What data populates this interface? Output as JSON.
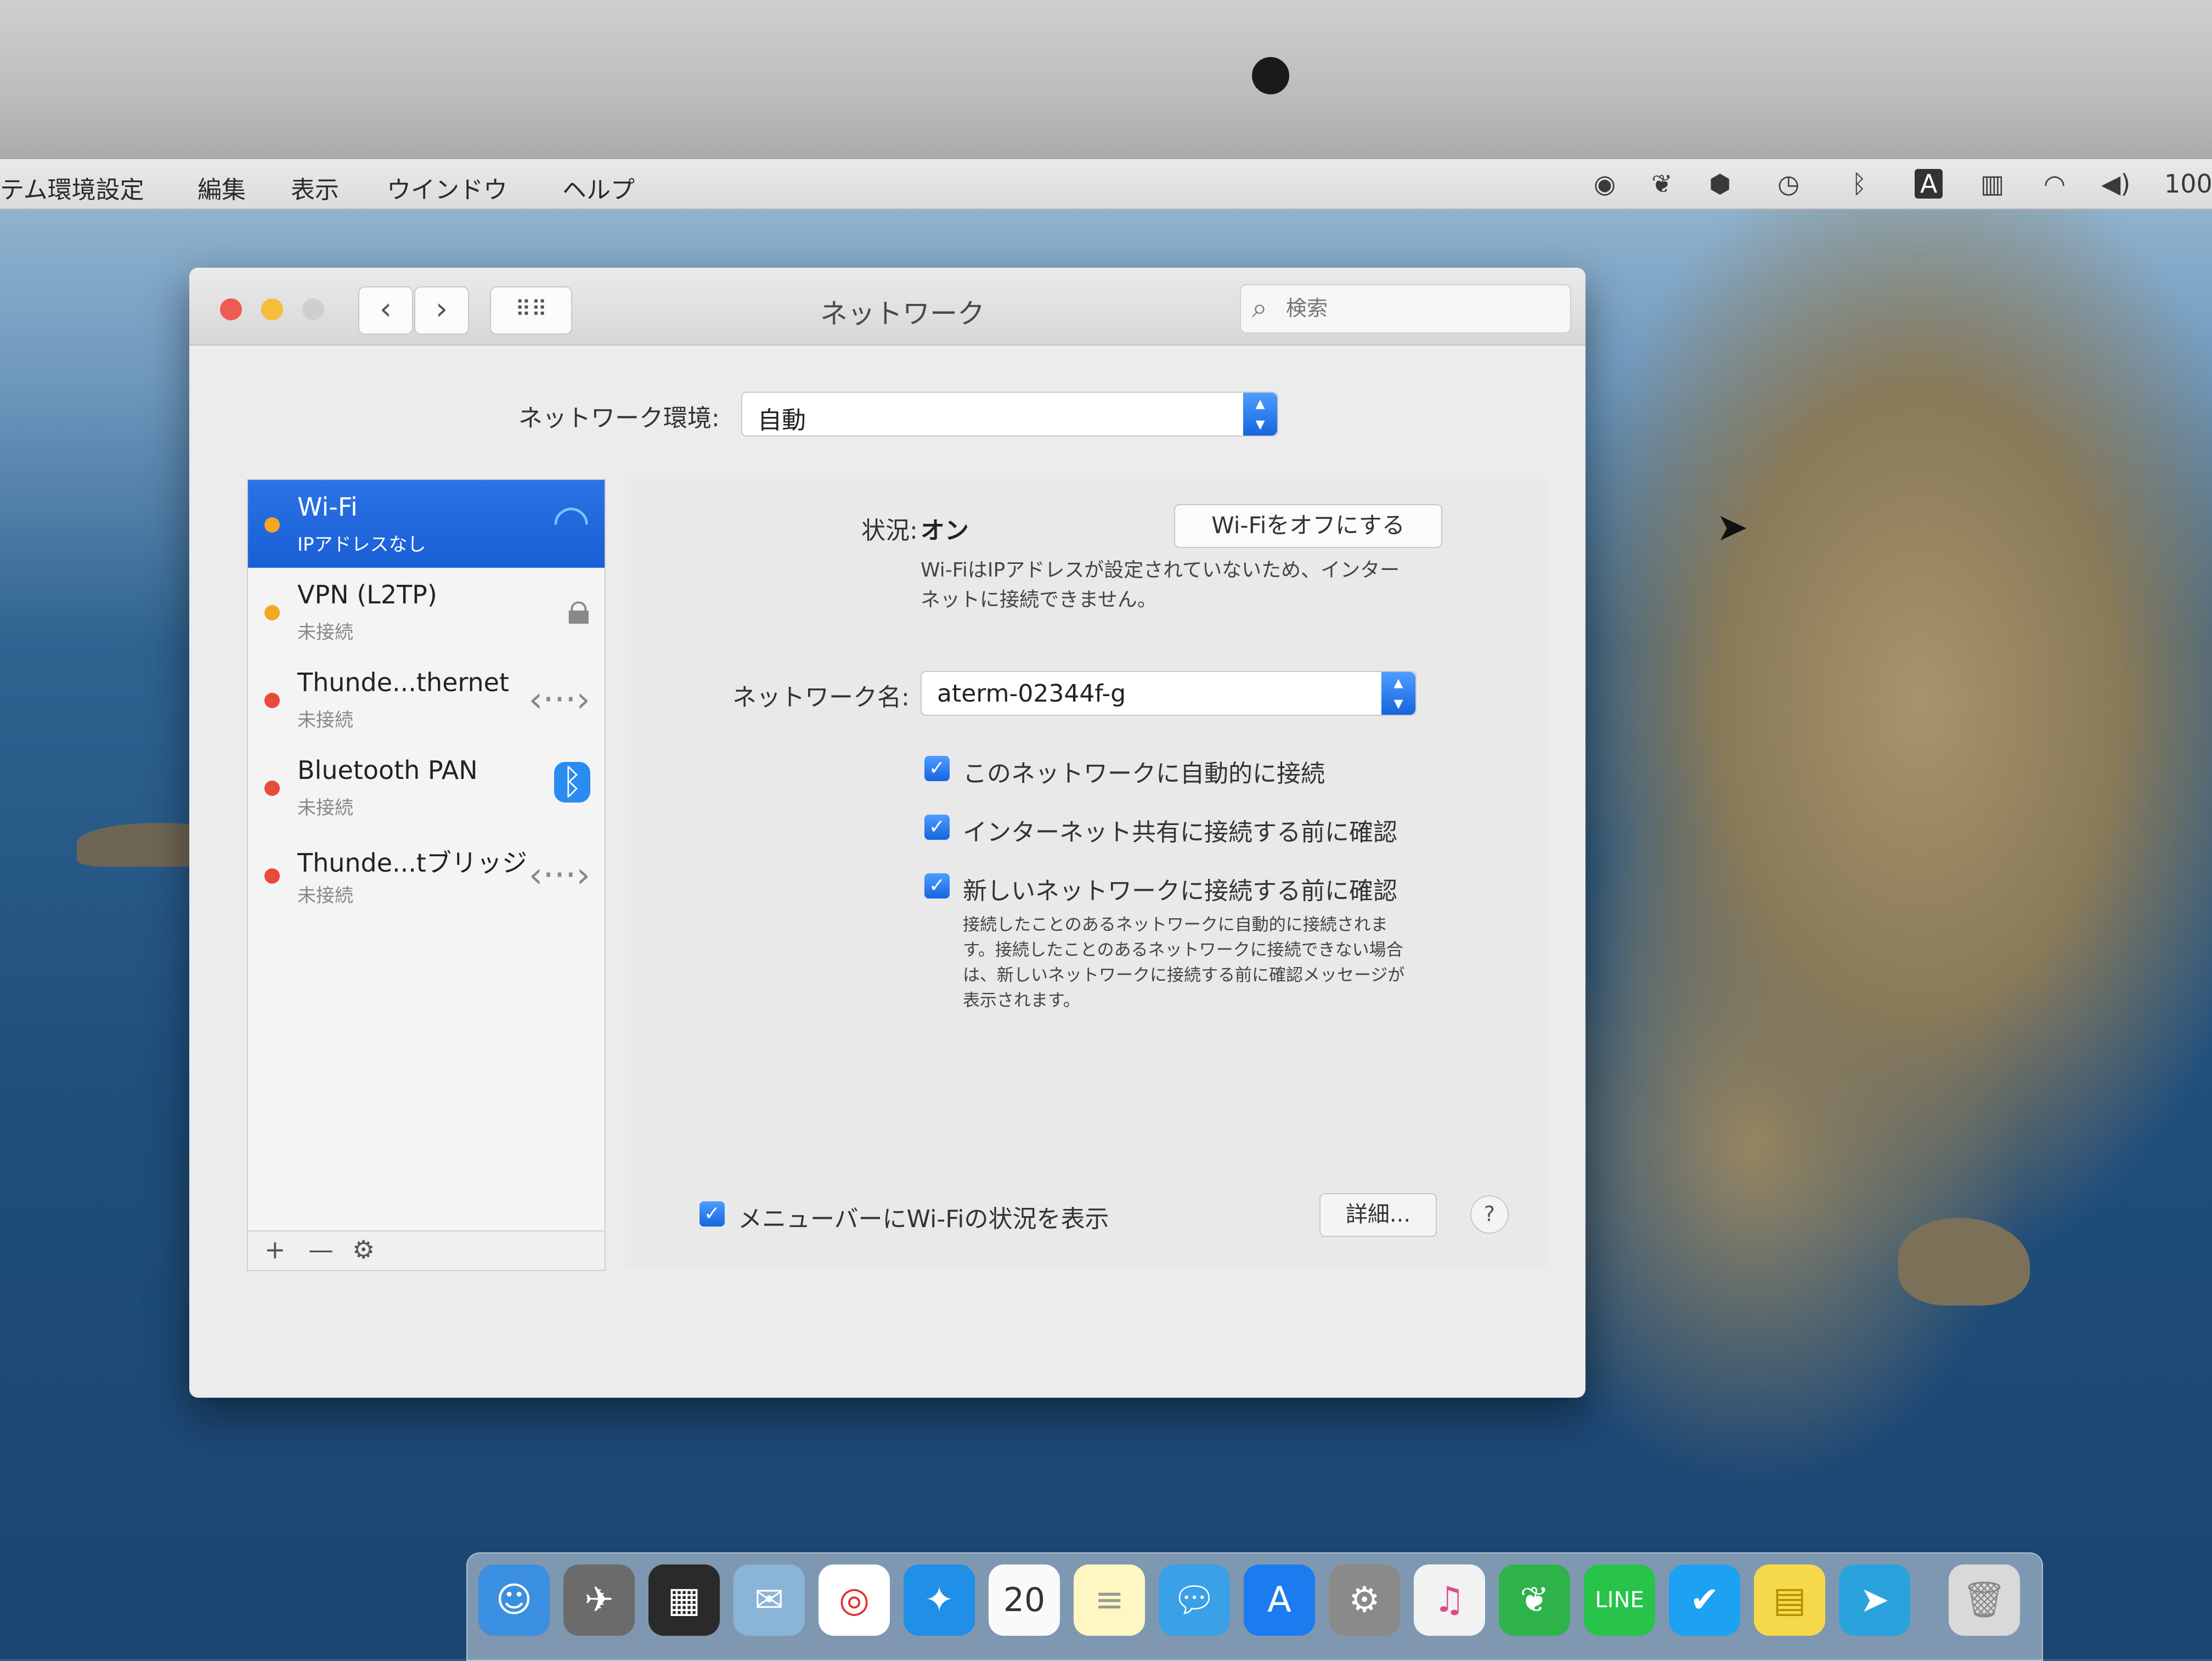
{
  "menubar": {
    "items": [
      "テム環境設定",
      "編集",
      "表示",
      "ウインドウ",
      "ヘルプ"
    ],
    "battery": "100"
  },
  "window": {
    "title": "ネットワーク",
    "search_placeholder": "検索"
  },
  "location": {
    "label": "ネットワーク環境:",
    "value": "自動"
  },
  "services": [
    {
      "name": "Wi-Fi",
      "status": "IPアドレスなし",
      "dot": "#f5a623",
      "icon": "wifi-icon",
      "selected": true
    },
    {
      "name": "VPN (L2TP)",
      "status": "未接続",
      "dot": "#f5a623",
      "icon": "lock-icon",
      "selected": false
    },
    {
      "name": "Thunde...thernet",
      "status": "未接続",
      "dot": "#e84a3c",
      "icon": "ethernet-icon",
      "selected": false
    },
    {
      "name": "Bluetooth PAN",
      "status": "未接続",
      "dot": "#e84a3c",
      "icon": "bluetooth-icon",
      "selected": false
    },
    {
      "name": "Thunde...tブリッジ",
      "status": "未接続",
      "dot": "#e84a3c",
      "icon": "bridge-icon",
      "selected": false
    }
  ],
  "list_toolbar": {
    "add": "+",
    "remove": "—",
    "gear": "⚙"
  },
  "detail": {
    "status_label": "状況:",
    "status_value": "オン",
    "wifi_off_button": "Wi-Fiをオフにする",
    "status_description": "Wi-FiはIPアドレスが設定されていないため、インターネットに接続できません。",
    "network_name_label": "ネットワーク名:",
    "network_name_value": "aterm-02344f-g",
    "checkboxes": [
      {
        "label": "このネットワークに自動的に接続",
        "checked": true
      },
      {
        "label": "インターネット共有に接続する前に確認",
        "checked": true
      },
      {
        "label": "新しいネットワークに接続する前に確認",
        "checked": true
      }
    ],
    "checkbox_help": "接続したことのあるネットワークに自動的に接続されます。接続したことのあるネットワークに接続できない場合は、新しいネットワークに接続する前に確認メッセージが表示されます。",
    "menubar_checkbox_label": "メニューバーにWi-Fiの状況を表示",
    "advanced_button": "詳細...",
    "help_button": "?"
  },
  "colors": {
    "accent": "#1a6fe8",
    "selected_row": "#1f63d9",
    "dot_yellow": "#f5a623",
    "dot_red": "#e84a3c"
  },
  "dock": {
    "calendar_day": "20"
  }
}
